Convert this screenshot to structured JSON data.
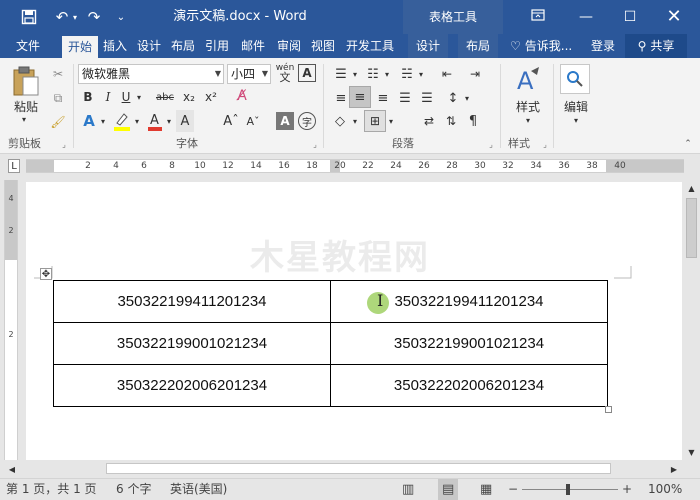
{
  "window": {
    "title": "演示文稿.docx - Word",
    "context_tab_group": "表格工具"
  },
  "quick_access": {
    "save_icon": "save-icon",
    "undo_icon": "undo-icon",
    "redo_icon": "redo-icon",
    "customize_icon": "customize-qa-icon"
  },
  "tabs": [
    {
      "label": "文件"
    },
    {
      "label": "开始"
    },
    {
      "label": "插入"
    },
    {
      "label": "设计"
    },
    {
      "label": "布局"
    },
    {
      "label": "引用"
    },
    {
      "label": "邮件"
    },
    {
      "label": "审阅"
    },
    {
      "label": "视图"
    },
    {
      "label": "开发工具"
    },
    {
      "label": "设计"
    },
    {
      "label": "布局"
    }
  ],
  "tellme": "告诉我...",
  "login": "登录",
  "share": "共享",
  "ribbon": {
    "paste_label": "粘贴",
    "font_name": "微软雅黑",
    "font_size": "小四",
    "wen_label": "wén",
    "style_label": "样式",
    "edit_label": "编辑",
    "groups": {
      "clipboard": "剪贴板",
      "font": "字体",
      "paragraph": "段落",
      "styles": "样式"
    }
  },
  "ruler": {
    "h_marks": [
      "2",
      "4",
      "6",
      "8",
      "10",
      "12",
      "14",
      "16",
      "18",
      "20",
      "22",
      "24",
      "26",
      "28",
      "30",
      "32",
      "34",
      "36",
      "38",
      "40"
    ],
    "v_marks": [
      "4",
      "2",
      "2"
    ]
  },
  "document": {
    "watermark": "木星教程网",
    "table": [
      [
        "350322199411201234",
        "350322199411201234"
      ],
      [
        "350322199001021234",
        "350322199001021234"
      ],
      [
        "350322202006201234",
        "350322202006201234"
      ]
    ]
  },
  "status": {
    "page": "第 1 页，共 1 页",
    "words": "6 个字",
    "lang": "英语(美国)",
    "zoom": "100%"
  },
  "colors": {
    "brand": "#2b579a",
    "context_band": "#375f9b",
    "ribbon_bg": "#f3f3f3",
    "cursor_highlight": "#9acd5a"
  }
}
